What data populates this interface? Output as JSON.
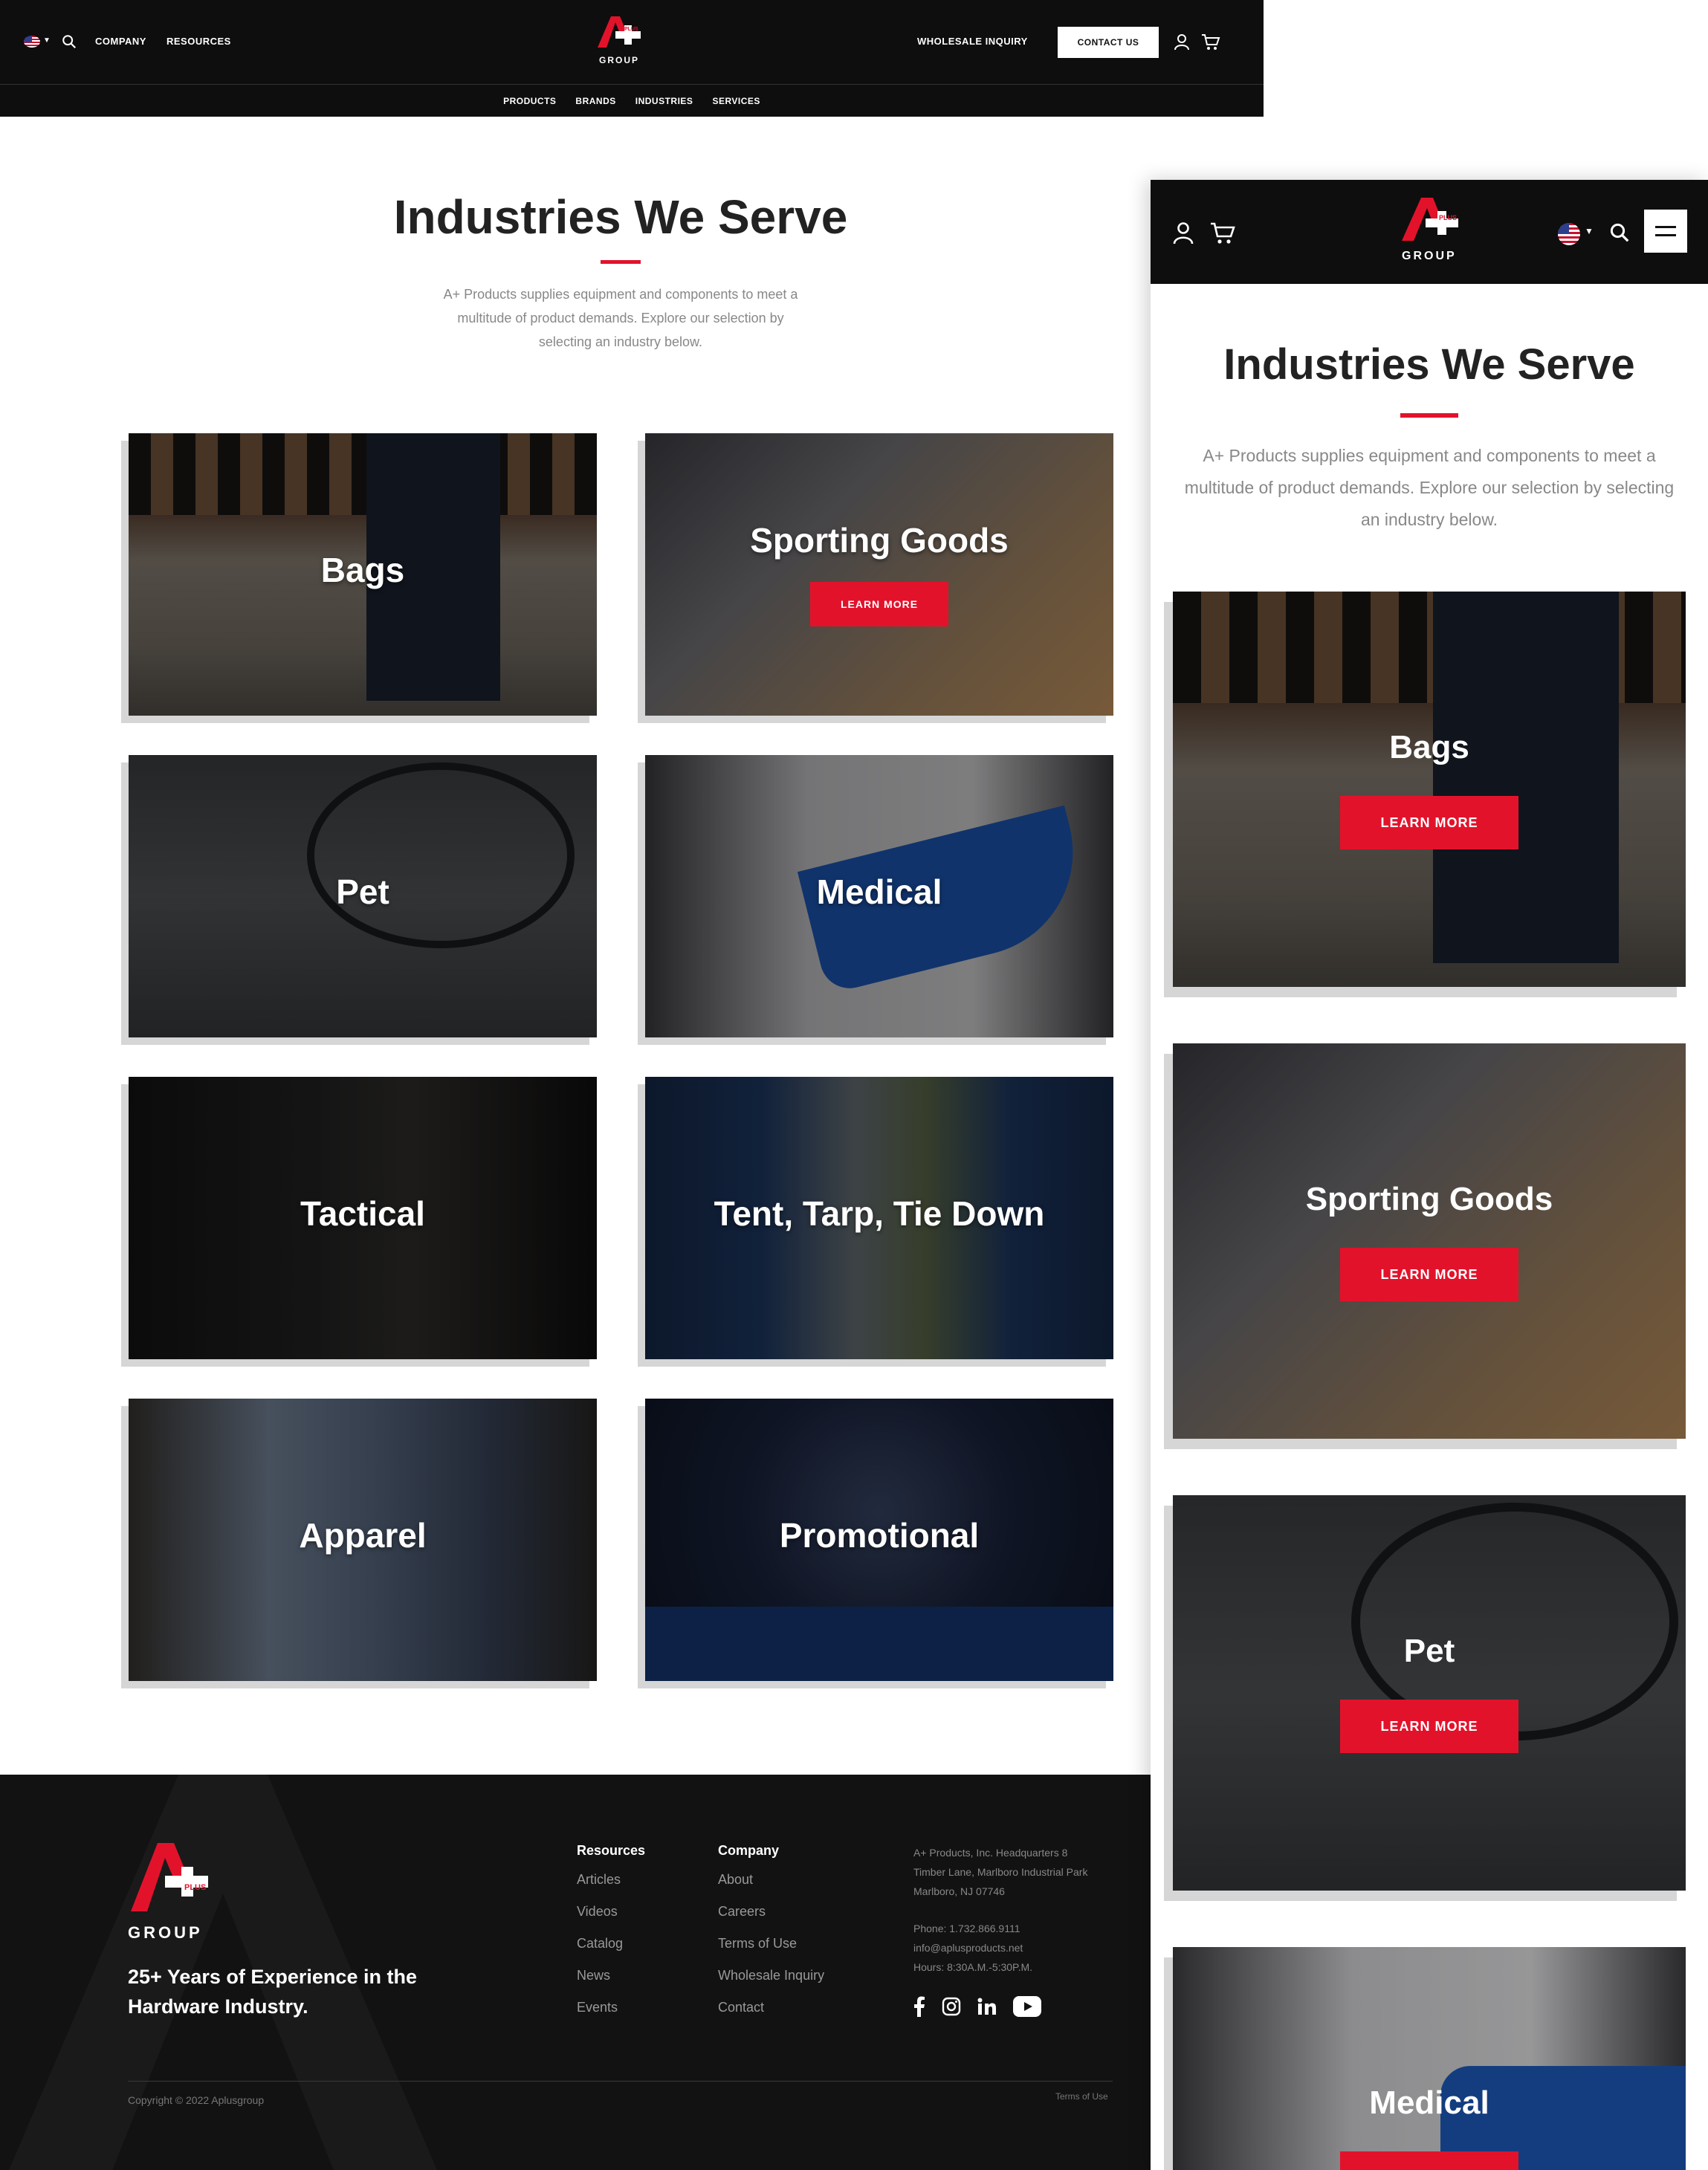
{
  "desktop": {
    "nav": {
      "top_left": [
        "COMPANY",
        "RESOURCES"
      ],
      "logo_text": "GROUP",
      "logo_badge": "PLUS",
      "wholesale": "WHOLESALE INQUIRY",
      "contact": "CONTACT US",
      "sub": [
        "PRODUCTS",
        "BRANDS",
        "INDUSTRIES",
        "SERVICES"
      ]
    },
    "title": "Industries We Serve",
    "intro": "A+ Products supplies equipment and components to meet a multitude of product demands. Explore our selection by selecting an industry below.",
    "cards": [
      {
        "title": "Bags"
      },
      {
        "title": "Sporting Goods",
        "button": "LEARN MORE"
      },
      {
        "title": "Pet"
      },
      {
        "title": "Medical"
      },
      {
        "title": "Tactical"
      },
      {
        "title": "Tent, Tarp, Tie Down"
      },
      {
        "title": "Apparel"
      },
      {
        "title": "Promotional"
      }
    ],
    "footer": {
      "logo_text": "GROUP",
      "logo_badge": "PLUS",
      "tagline": "25+ Years of Experience in the Hardware Industry.",
      "resources": {
        "heading": "Resources",
        "items": [
          "Articles",
          "Videos",
          "Catalog",
          "News",
          "Events"
        ]
      },
      "company": {
        "heading": "Company",
        "items": [
          "About",
          "Careers",
          "Terms of Use",
          "Wholesale Inquiry",
          "Contact"
        ]
      },
      "address": [
        "A+ Products, Inc. Headquarters 8",
        "Timber Lane, Marlboro Industrial Park",
        "Marlboro, NJ 07746"
      ],
      "contact": [
        "Phone: 1.732.866.9111",
        "info@aplusproducts.net",
        "Hours: 8:30A.M.-5:30P.M."
      ],
      "copyright": "Copyright © 2022 Aplusgroup",
      "terms": "Terms of Use"
    }
  },
  "mobile": {
    "logo_text": "GROUP",
    "logo_badge": "PLUS",
    "title": "Industries We Serve",
    "intro": "A+ Products supplies equipment and components to meet a multitude of product demands. Explore our selection by selecting an industry below.",
    "cards": [
      {
        "title": "Bags",
        "button": "LEARN MORE"
      },
      {
        "title": "Sporting Goods",
        "button": "LEARN MORE"
      },
      {
        "title": "Pet",
        "button": "LEARN MORE"
      },
      {
        "title": "Medical"
      }
    ]
  },
  "colors": {
    "accent": "#e3122b",
    "header_bg": "#0e0e0e",
    "footer_bg": "#121212"
  }
}
